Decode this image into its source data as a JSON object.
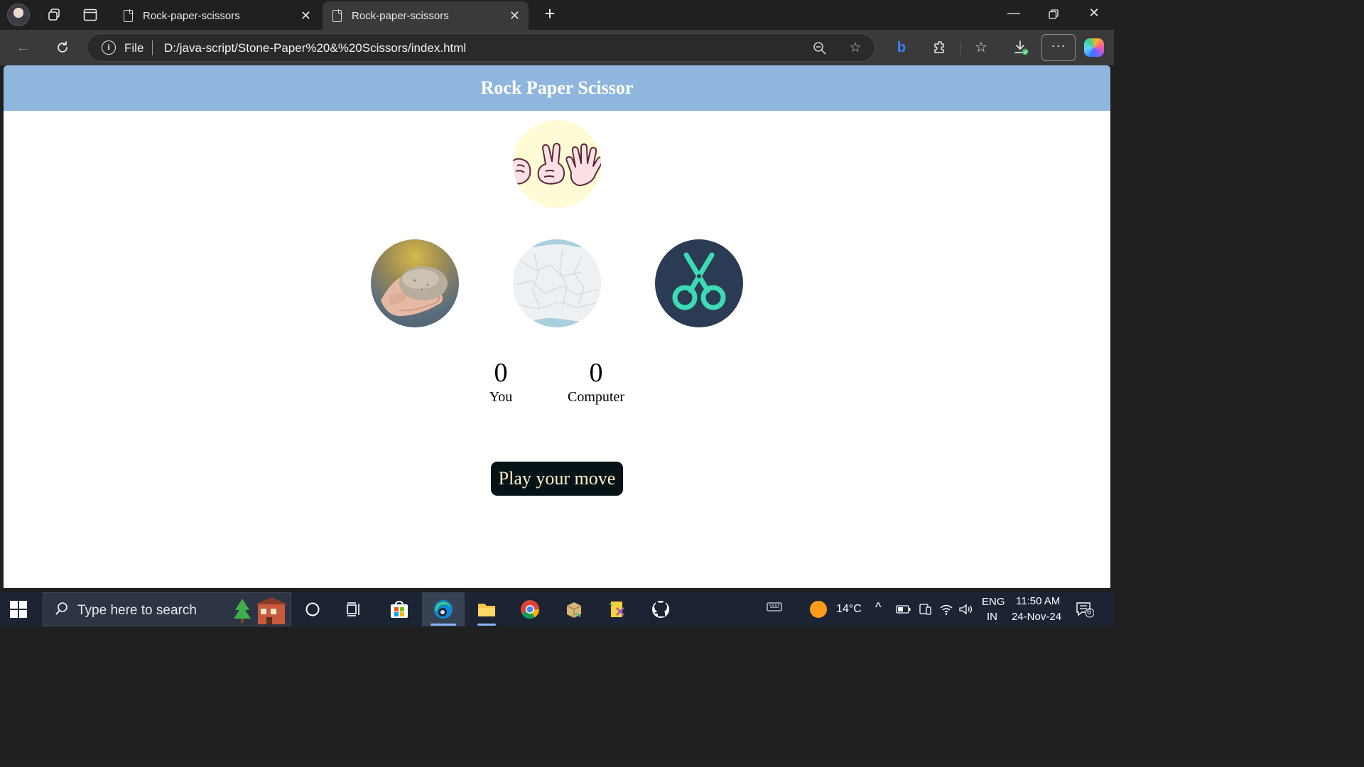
{
  "browser": {
    "tabs": [
      {
        "title": "Rock-paper-scissors",
        "active": false
      },
      {
        "title": "Rock-paper-scissors",
        "active": true
      }
    ],
    "address": {
      "scheme_label": "File",
      "url": "D:/java-script/Stone-Paper%20&%20Scissors/index.html"
    }
  },
  "page": {
    "title": "Rock Paper Scissor",
    "choices": [
      {
        "id": "rock",
        "icon": "rock-in-hand-image"
      },
      {
        "id": "paper",
        "icon": "crumpled-paper-image"
      },
      {
        "id": "scissors",
        "icon": "scissors-icon"
      }
    ],
    "score": {
      "user_score": "0",
      "user_label": "You",
      "computer_score": "0",
      "computer_label": "Computer"
    },
    "message": "Play your move",
    "colors": {
      "header_bg": "#8fb7de",
      "message_bg": "#071317",
      "scissors_bg": "#2b3b54",
      "scissors_fg": "#3ddbb5"
    }
  },
  "taskbar": {
    "search_placeholder": "Type here to search",
    "weather": "14°C",
    "language_top": "ENG",
    "language_bottom": "IN",
    "time": "11:50 AM",
    "date": "24-Nov-24",
    "notification_count": "6"
  }
}
